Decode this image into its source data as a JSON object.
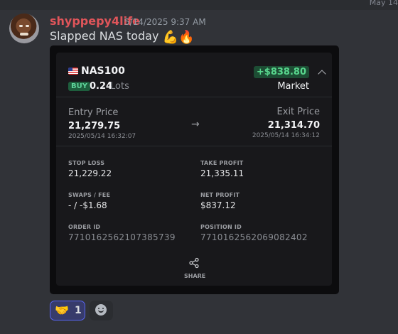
{
  "header": {
    "top_date": "May 14"
  },
  "message": {
    "username": "shyppepy4life",
    "timestamp": "5/14/2025 9:37 AM",
    "text": "Slapped NAS today",
    "emojis": [
      "💪",
      "🔥"
    ]
  },
  "trade": {
    "symbol": "NAS100",
    "side": "BUY",
    "lots_value": "0.24",
    "lots_unit": "Lots",
    "pnl": "+$838.80",
    "order_type": "Market",
    "entry": {
      "label": "Entry Price",
      "price": "21,279.75",
      "time": "2025/05/14 16:32:07"
    },
    "exit": {
      "label": "Exit Price",
      "price": "21,314.70",
      "time": "2025/05/14 16:34:12"
    },
    "stop_loss": {
      "label": "STOP LOSS",
      "value": "21,229.22"
    },
    "take_profit": {
      "label": "TAKE PROFIT",
      "value": "21,335.11"
    },
    "swaps_fee": {
      "label": "SWAPS / FEE",
      "value": "- / -$1.68"
    },
    "net_profit": {
      "label": "NET PROFIT",
      "value": "$837.12"
    },
    "order_id": {
      "label": "ORDER ID",
      "value": "7710162562107385739"
    },
    "position_id": {
      "label": "POSITION ID",
      "value": "7710162562069082402"
    },
    "share_label": "SHARE"
  },
  "reactions": [
    {
      "emoji": "🤝",
      "count": "1"
    }
  ],
  "colors": {
    "profit": "#58d68d",
    "buy": "#5fd39a",
    "username": "#e0555a",
    "reaction_border": "#5865f2"
  }
}
